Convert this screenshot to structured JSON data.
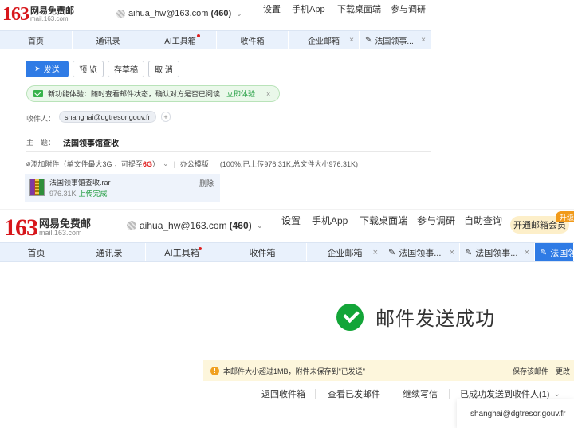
{
  "header": {
    "logo_number": "163",
    "logo_name": "网易免费邮",
    "logo_domain": "mail.163.com",
    "user": "aihua_hw@163.com",
    "unread_count": "(460)",
    "nav": [
      "设置",
      "手机App",
      "下载桌面端",
      "参与调研"
    ],
    "nav_extra": "自助查询",
    "vip_label": "开通邮箱会员",
    "vip_badge": "升级"
  },
  "tabs_top": [
    {
      "label": "首页"
    },
    {
      "label": "通讯录"
    },
    {
      "label": "AI工具箱"
    },
    {
      "label": "收件箱"
    },
    {
      "label": "企业邮箱"
    },
    {
      "label": "法国领事..."
    }
  ],
  "tabs_bottom": [
    {
      "label": "首页"
    },
    {
      "label": "通讯录"
    },
    {
      "label": "AI工具箱"
    },
    {
      "label": "收件箱"
    },
    {
      "label": "企业邮箱"
    },
    {
      "label": "法国领事..."
    },
    {
      "label": "法国领事..."
    },
    {
      "label": "法国领"
    }
  ],
  "compose": {
    "send_label": "发送",
    "preview_label": "预 览",
    "draft_label": "存草稿",
    "cancel_label": "取 消",
    "banner_text": "新功能体验：随时查看邮件状态，确认对方是否已阅读",
    "banner_link": "立即体验",
    "recipient_label": "收件人：",
    "recipient": "shanghai@dgtresor.gouv.fr",
    "subject_label": "主　题：",
    "subject": "法国领事馆查收",
    "attach_label": "添加附件",
    "attach_hint": "（单文件最大3G ，可提至",
    "attach_hint_red": "6G",
    "attach_hint_close": "）",
    "office_template": "办公模版",
    "upload_summary": "(100%,已上传976.31K,总文件大小976.31K)",
    "file_name": "法国领事馆查收.rar",
    "file_size": "976.31K",
    "file_status": "上传完成",
    "delete_label": "删除"
  },
  "result": {
    "success_text": "邮件发送成功",
    "warning_text": "本邮件大小超过1MB，附件未保存到\"已发送\"",
    "save_mail": "保存该邮件",
    "change": "更改",
    "actions": [
      "返回收件箱",
      "查看已发邮件",
      "继续写信",
      "已成功发送到收件人(1)"
    ],
    "recipient_list": [
      "shanghai@dgtresor.gouv.fr"
    ]
  }
}
